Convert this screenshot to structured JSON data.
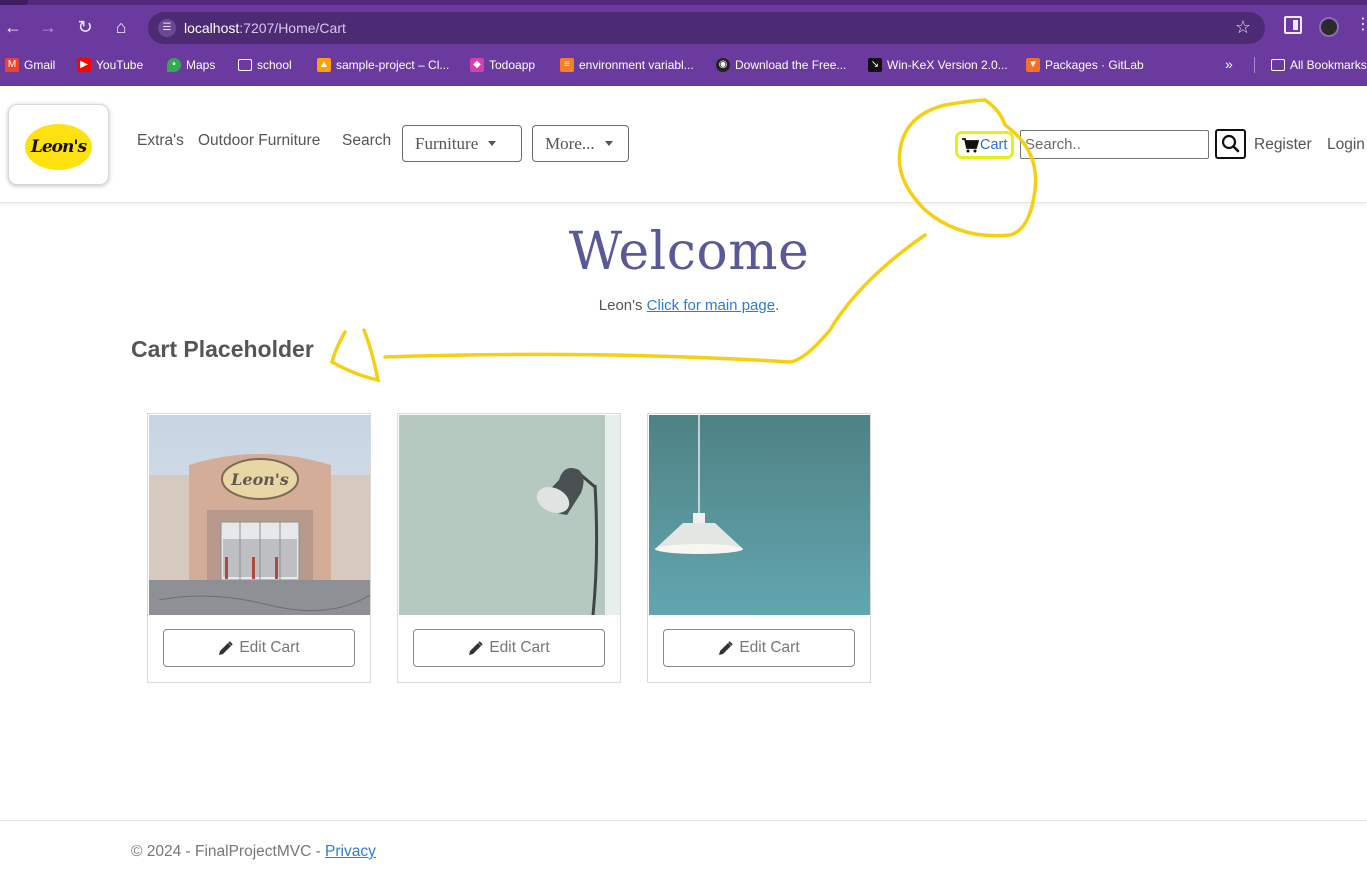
{
  "browser": {
    "url_host": "localhost",
    "url_path": ":7207/Home/Cart",
    "bookmarks": [
      {
        "label": "Gmail",
        "icon": "gmail-icon",
        "color": "#ea4335"
      },
      {
        "label": "YouTube",
        "icon": "youtube-icon",
        "color": "#ff0000"
      },
      {
        "label": "Maps",
        "icon": "maps-icon",
        "color": "#34a853"
      },
      {
        "label": "school",
        "icon": "folder-icon",
        "color": "#6a3a9e"
      },
      {
        "label": "sample-project – Cl...",
        "icon": "firebase-icon",
        "color": "#ffa000"
      },
      {
        "label": "Todoapp",
        "icon": "todoapp-icon",
        "color": "#d23fb2"
      },
      {
        "label": "environment variabl...",
        "icon": "stackoverflow-icon",
        "color": "#f48024"
      },
      {
        "label": "Download the Free...",
        "icon": "eye-icon",
        "color": "#222222"
      },
      {
        "label": "Win-KeX Version 2.0...",
        "icon": "kali-icon",
        "color": "#111111"
      },
      {
        "label": "Packages · GitLab",
        "icon": "gitlab-icon",
        "color": "#fc6d26"
      }
    ],
    "all_bookmarks": "All Bookmarks"
  },
  "header": {
    "logo_text": "Leon's",
    "nav": [
      "Extra's",
      "Outdoor Furniture",
      "Search"
    ],
    "dropdowns": [
      "Furniture",
      "More..."
    ],
    "cart_label": "Cart",
    "search_placeholder": "Search..",
    "register": "Register",
    "login": "Login"
  },
  "main": {
    "welcome": "Welcome",
    "sub_prefix": "Leon's ",
    "sub_link": "Click for main page",
    "sub_suffix": ".",
    "cart_title": "Cart Placeholder",
    "cards": [
      {
        "image": "store-front-photo",
        "button": "Edit Cart"
      },
      {
        "image": "floor-lamp-photo",
        "button": "Edit Cart"
      },
      {
        "image": "pendant-lamp-photo",
        "button": "Edit Cart"
      }
    ]
  },
  "footer": {
    "text": "© 2024 - FinalProjectMVC - ",
    "link": "Privacy"
  },
  "colors": {
    "browser_frame": "#6a3a9e",
    "heading": "#585996",
    "link": "#2b7cd8",
    "annotation": "#f6cf13",
    "logo_yellow": "#ffe10f"
  }
}
